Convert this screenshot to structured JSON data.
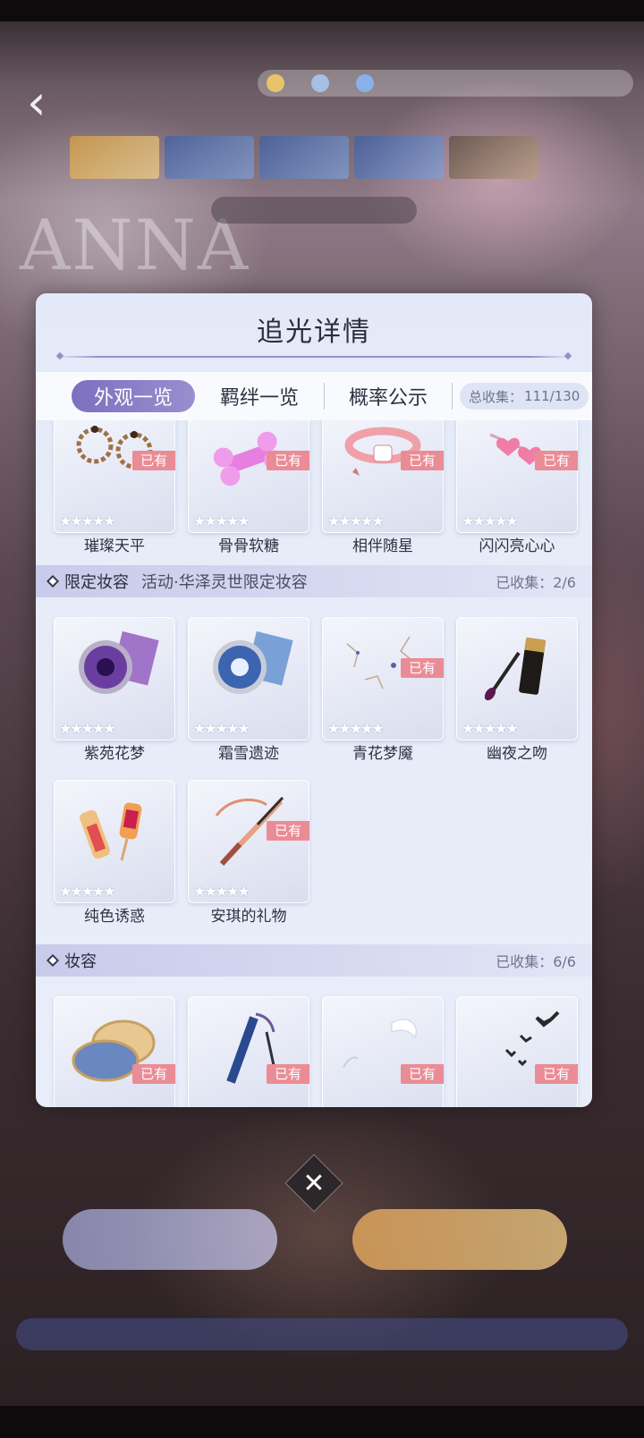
{
  "background": {
    "watermark": "ANNA",
    "currency": [
      "",
      "",
      ""
    ]
  },
  "modal": {
    "title": "追光详情",
    "tabs": [
      {
        "label": "外观一览",
        "active": true
      },
      {
        "label": "羁绊一览",
        "active": false
      },
      {
        "label": "概率公示",
        "active": false
      }
    ],
    "total": {
      "label": "总收集：",
      "value": "111/130"
    },
    "owned_badge": "已有",
    "top_items": [
      {
        "name": "璀璨天平",
        "owned": true,
        "icon": "earrings-icon"
      },
      {
        "name": "骨骨软糖",
        "owned": true,
        "icon": "bone-candy-icon"
      },
      {
        "name": "相伴随星",
        "owned": true,
        "icon": "collar-icon"
      },
      {
        "name": "闪闪亮心心",
        "owned": true,
        "icon": "heart-hairpin-icon"
      }
    ],
    "sections": [
      {
        "title": "限定妆容",
        "subtitle": "活动·华泽灵世限定妆容",
        "count": "已收集：2/6",
        "items": [
          {
            "name": "紫苑花梦",
            "owned": false,
            "icon": "purple-lens-icon"
          },
          {
            "name": "霜雪遗迹",
            "owned": false,
            "icon": "snow-lens-icon"
          },
          {
            "name": "青花梦魇",
            "owned": true,
            "icon": "face-paint-icon"
          },
          {
            "name": "幽夜之吻",
            "owned": false,
            "icon": "lipstick-icon"
          },
          {
            "name": "纯色诱惑",
            "owned": false,
            "icon": "lip-gloss-icon"
          },
          {
            "name": "安琪的礼物",
            "owned": true,
            "icon": "eyeliner-icon"
          }
        ]
      },
      {
        "title": "妆容",
        "subtitle": "",
        "count": "已收集：6/6",
        "items": [
          {
            "name": "",
            "owned": true,
            "icon": "compact-icon"
          },
          {
            "name": "",
            "owned": true,
            "icon": "mascara-icon"
          },
          {
            "name": "",
            "owned": true,
            "icon": "feather-icon"
          },
          {
            "name": "",
            "owned": true,
            "icon": "birds-icon"
          }
        ]
      }
    ]
  },
  "close_label": "✕",
  "back_label": "‹"
}
